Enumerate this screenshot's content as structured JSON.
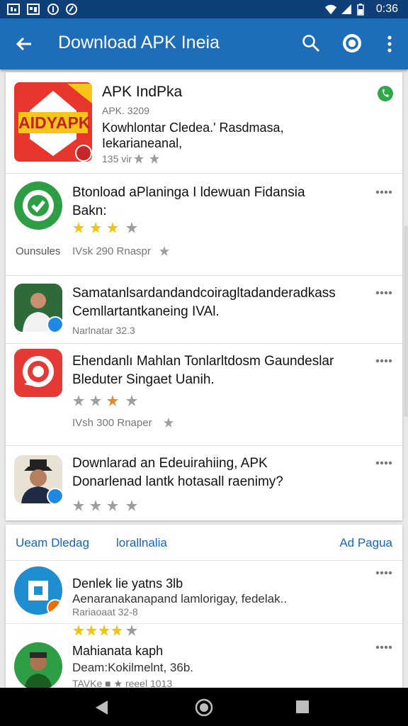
{
  "status_bar": {
    "time": "0:36"
  },
  "app_bar": {
    "title": "Download APK Ineia"
  },
  "featured": {
    "name": "APK IndPka",
    "meta": "APK. 3209",
    "desc_line1": "Kowhlontar Cledea.' Rasdmasa,",
    "desc_line2": "Iekarianeanal,",
    "rating_text": "135 vir",
    "icon_text": "AIDYAPK",
    "stars": "2 of 3"
  },
  "apps": [
    {
      "title_line1": "Btonload aPlaningа I ldewuan Fidansia",
      "title_line2": "Bakn:",
      "stars": "4 of 5",
      "left_label": "Ounsules",
      "info": "IVsk 290 Rnaspr"
    },
    {
      "title_line1": "Samatanlsardandandcoiragltadanderadkass",
      "title_line2": "Cemllartantkaneing IVAl.",
      "sub": "Narlnatar 32.3"
    },
    {
      "title_line1": "Ehendanlı Mahlan Tonlarltdosm Gaundeslar",
      "title_line2": "Bleduter Singaet Uanih.",
      "stars": "1 highlighted of 4",
      "info": "IVsh 300 Rnaper"
    },
    {
      "title_line1": "Downlarad an Edeuirahiing, APK",
      "title_line2": "Donarlenad lantk  hotasall raenimy?",
      "stars": "0 of 4"
    }
  ],
  "links": {
    "left": "Ueam Dledag",
    "middle": "lorallnalia",
    "right": "Ad Pagua"
  },
  "more_apps": [
    {
      "title": "Denlek lie yatns 3lb",
      "desc": "Aenaranakanapand lamlorigay, fedelak..",
      "sub": "Rariaoaat 32-8",
      "stars": "4 of 5"
    },
    {
      "title": "Mahianata kaph",
      "desc": "Deam:Kokilmelnt, 36b.",
      "sub": "TAVKe ■ ★ reeel 1013"
    }
  ],
  "colors": {
    "status_bar": "#0f3f78",
    "app_bar": "#1d6db8",
    "star_gold": "#f2c40f",
    "star_gray": "#9e9e9e",
    "link": "#1565c0"
  }
}
